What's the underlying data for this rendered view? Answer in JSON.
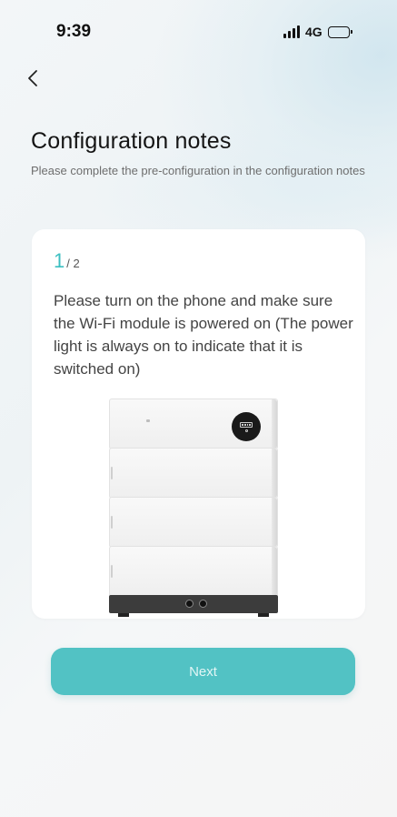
{
  "status_bar": {
    "time": "9:39",
    "network": "4G",
    "icons": [
      "cellular-signal-icon",
      "battery-icon"
    ]
  },
  "header": {
    "back_icon": "chevron-left-icon",
    "title": "Configuration notes",
    "subtitle": "Please complete the pre-configuration in the configuration notes"
  },
  "card": {
    "step_current": "1",
    "step_total": "/ 2",
    "instruction": "Please turn on the phone and make sure the Wi-Fi module is powered on (The power light is always on to indicate that it is switched on)",
    "image": "battery-storage-device-image"
  },
  "actions": {
    "next_label": "Next"
  },
  "colors": {
    "accent": "#3cbfc1",
    "button": "#52c2c4",
    "button_text": "#e2f5f5",
    "background": "#f4f6f7",
    "card": "#ffffff"
  }
}
